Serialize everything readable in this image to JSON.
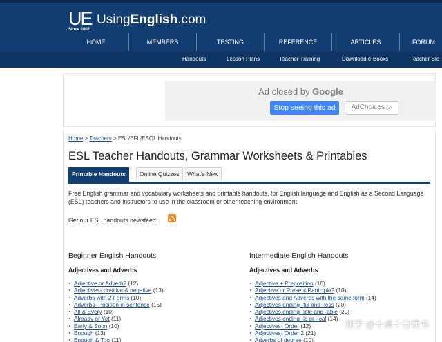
{
  "site": {
    "logo_mark": "UE",
    "since": "Since 2002",
    "name_prefix": "Using",
    "name_bold": "English",
    "name_suffix": ".com"
  },
  "main_nav": [
    "HOME",
    "MEMBERS",
    "TESTING",
    "REFERENCE",
    "ARTICLES",
    "FORUM"
  ],
  "sub_nav": [
    "Handouts",
    "Lesson Plans",
    "Teacher Training",
    "Download e-Books",
    "Teacher Blo"
  ],
  "ad": {
    "closed_text": "Ad closed by",
    "closed_brand": "Google",
    "stop_button": "Stop seeing this ad",
    "adchoices": "AdChoices ▷"
  },
  "breadcrumb": {
    "home": "Home",
    "sep1": ">",
    "teachers": "Teachers",
    "sep2": ">",
    "current": "ESL/EFL/ESOL Handouts"
  },
  "page_title": "ESL Teacher Handouts, Grammar Worksheets & Printables",
  "tabs": [
    "Printable Handouts",
    "Online Quizzes",
    "What's New"
  ],
  "intro": "Free English grammar and vocabulary worksheets and printable handouts, for English language and English as a Second Language (ESL) teachers and instructors to use in the classroom or other teaching environment.",
  "newsfeed": "Get our ESL handouts newsfeed:",
  "beginner": {
    "heading": "Beginner English Handouts",
    "subheading": "Adjectives and Adverbs",
    "items": [
      {
        "label": "Adjective or Adverb?",
        "count": "(12)"
      },
      {
        "label": "Adjectives- positive & negative",
        "count": "(13)"
      },
      {
        "label": "Adverbs with 2 Forms",
        "count": "(10)"
      },
      {
        "label": "Adverbs- Position in sentence",
        "count": "(15)"
      },
      {
        "label": "All & Every",
        "count": "(10)"
      },
      {
        "label": "Already or Yet",
        "count": "(11)"
      },
      {
        "label": "Early & Soon",
        "count": "(10)"
      },
      {
        "label": "Enough",
        "count": "(13)"
      },
      {
        "label": "Enough & Too",
        "count": "(11)"
      }
    ]
  },
  "intermediate": {
    "heading": "Intermediate English Handouts",
    "subheading": "Adjectives and Adverbs",
    "items": [
      {
        "label": "Adjective + Preposition",
        "count": "(10)"
      },
      {
        "label": "Adjective or Present Participle?",
        "count": "(10)"
      },
      {
        "label": "Adjectives and Adverbs with the same form",
        "count": "(14)"
      },
      {
        "label": "Adjectives ending -ful and -less",
        "count": "(20)"
      },
      {
        "label": "Adjectives ending -ible and -able",
        "count": "(20)"
      },
      {
        "label": "Adjectives ending -ic or -ical",
        "count": "(14)"
      },
      {
        "label": "Adjectives- Order",
        "count": "(12)"
      },
      {
        "label": "Adjectives- Order 2",
        "count": "(21)"
      },
      {
        "label": "Adverbs of degree",
        "count": "(10)"
      }
    ]
  },
  "watermark": "知乎 @十点十分读书",
  "colors": {
    "header_bg": "#123e72",
    "subnav_bg": "#0e3564",
    "link": "#1a4d8f",
    "ad_button": "#4285f4",
    "rss": "#f08a24"
  }
}
